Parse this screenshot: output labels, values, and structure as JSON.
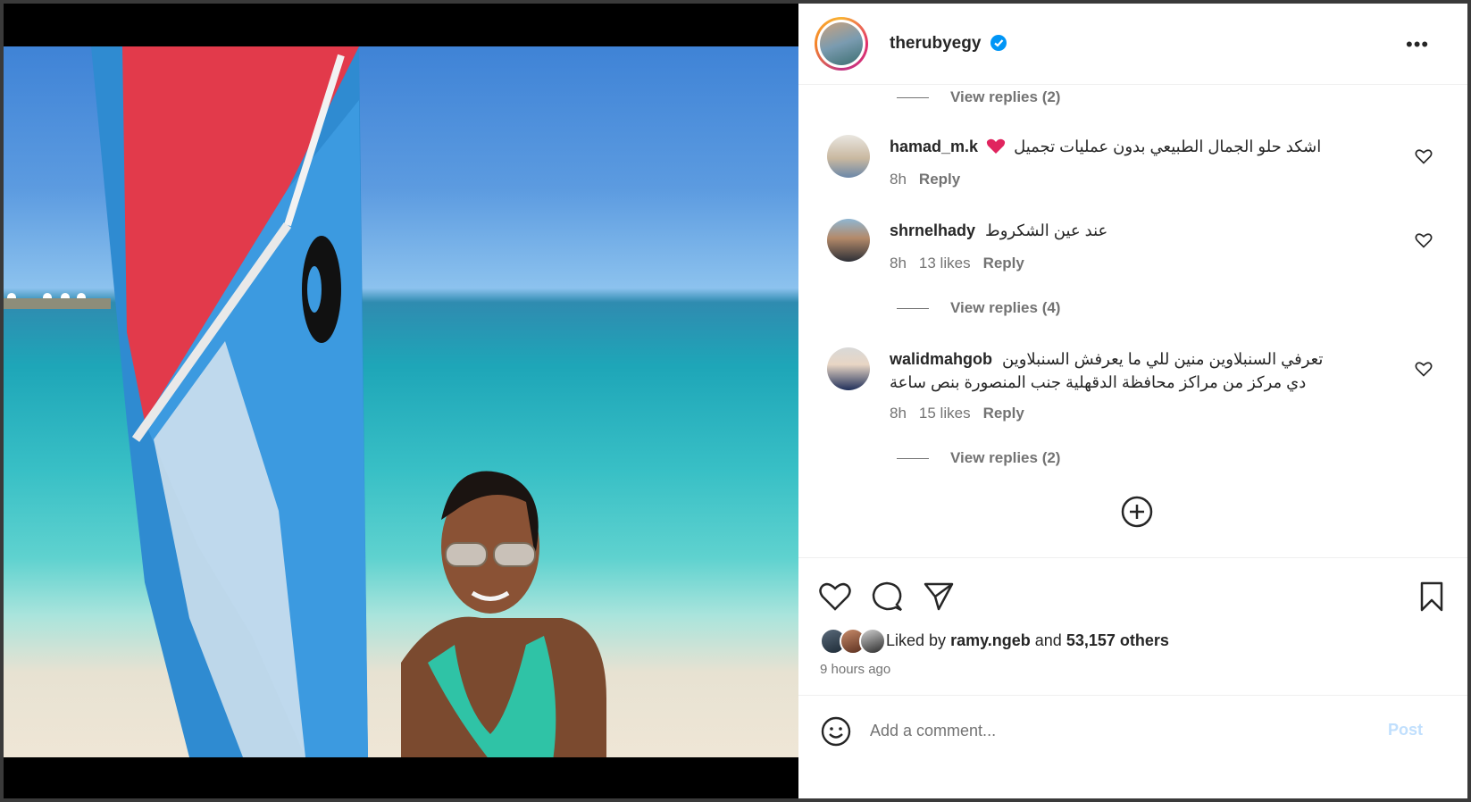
{
  "post": {
    "username": "therubyegy",
    "more_label": "•••"
  },
  "comments": {
    "view_replies_top": "View replies (2)",
    "items": [
      {
        "username": "hamad_m.k",
        "text": "اشكد حلو الجمال الطبيعي بدون عمليات تجميل",
        "time": "8h",
        "likes": "",
        "reply": "Reply"
      },
      {
        "username": "shrnelhady",
        "text": "عند عين الشكروط",
        "time": "8h",
        "likes": "13 likes",
        "reply": "Reply",
        "view_replies": "View replies (4)"
      },
      {
        "username": "walidmahgob",
        "text_line1": "تعرفي السنبلاوين منين للي ما يعرفش السنبلاوين",
        "text_line2": "دي مركز من مراكز محافظة الدقهلية جنب المنصورة بنص ساعة",
        "time": "8h",
        "likes": "15 likes",
        "reply": "Reply",
        "view_replies": "View replies (2)"
      }
    ]
  },
  "actions": {
    "liked_by_prefix": "Liked by",
    "liked_by_user": "ramy.ngeb",
    "liked_by_and": "and",
    "liked_by_others": "53,157 others",
    "time_ago": "9 hours ago"
  },
  "add_comment": {
    "placeholder": "Add a comment...",
    "post_label": "Post"
  },
  "colors": {
    "verified": "#0095f6",
    "heart_emoji": "#e0245e"
  }
}
